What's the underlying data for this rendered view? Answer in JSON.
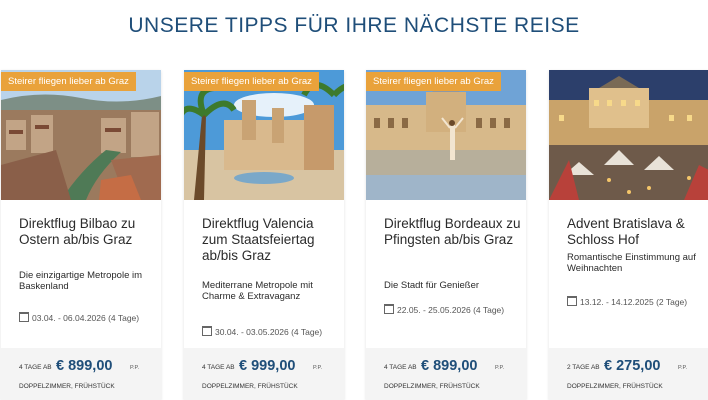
{
  "heading": "UNSERE TIPPS FÜR IHRE NÄCHSTE REISE",
  "cards": [
    {
      "badge": "Steirer fliegen lieber ab Graz",
      "title": "Direktflug Bilbao zu Ostern ab/bis Graz",
      "subtitle": "Die einzigartige Metropole im Baskenland",
      "dates": "03.04. - 06.04.2026 (4 Tage)",
      "days": "4 TAGE AB",
      "price": "€ 899,00",
      "per_person": "P.P.",
      "board": "DOPPELZIMMER, FRÜHSTÜCK",
      "image": "bilbao-photo"
    },
    {
      "badge": "Steirer fliegen lieber ab Graz",
      "title": "Direktflug Valencia zum Staatsfeiertag ab/bis Graz",
      "subtitle": "Mediterrane Metropole mit Charme & Extravaganz",
      "dates": "30.04. - 03.05.2026 (4 Tage)",
      "days": "4 TAGE AB",
      "price": "€ 999,00",
      "per_person": "P.P.",
      "board": "DOPPELZIMMER, FRÜHSTÜCK",
      "image": "valencia-photo"
    },
    {
      "badge": "Steirer fliegen lieber ab Graz",
      "title": "Direktflug Bordeaux zu Pfingsten ab/bis Graz",
      "subtitle": "Die Stadt für Genießer",
      "dates": "22.05. - 25.05.2026 (4 Tage)",
      "days": "4 TAGE AB",
      "price": "€ 899,00",
      "per_person": "P.P.",
      "board": "DOPPELZIMMER, FRÜHSTÜCK",
      "image": "bordeaux-photo"
    },
    {
      "title": "Advent Bratislava & Schloss Hof",
      "subtitle": "Romantische Einstimmung auf Weihnachten",
      "dates": "13.12. - 14.12.2025 (2 Tage)",
      "days": "2 TAGE AB",
      "price": "€ 275,00",
      "per_person": "P.P.",
      "board": "DOPPELZIMMER, FRÜHSTÜCK",
      "image": "bratislava-photo"
    }
  ]
}
